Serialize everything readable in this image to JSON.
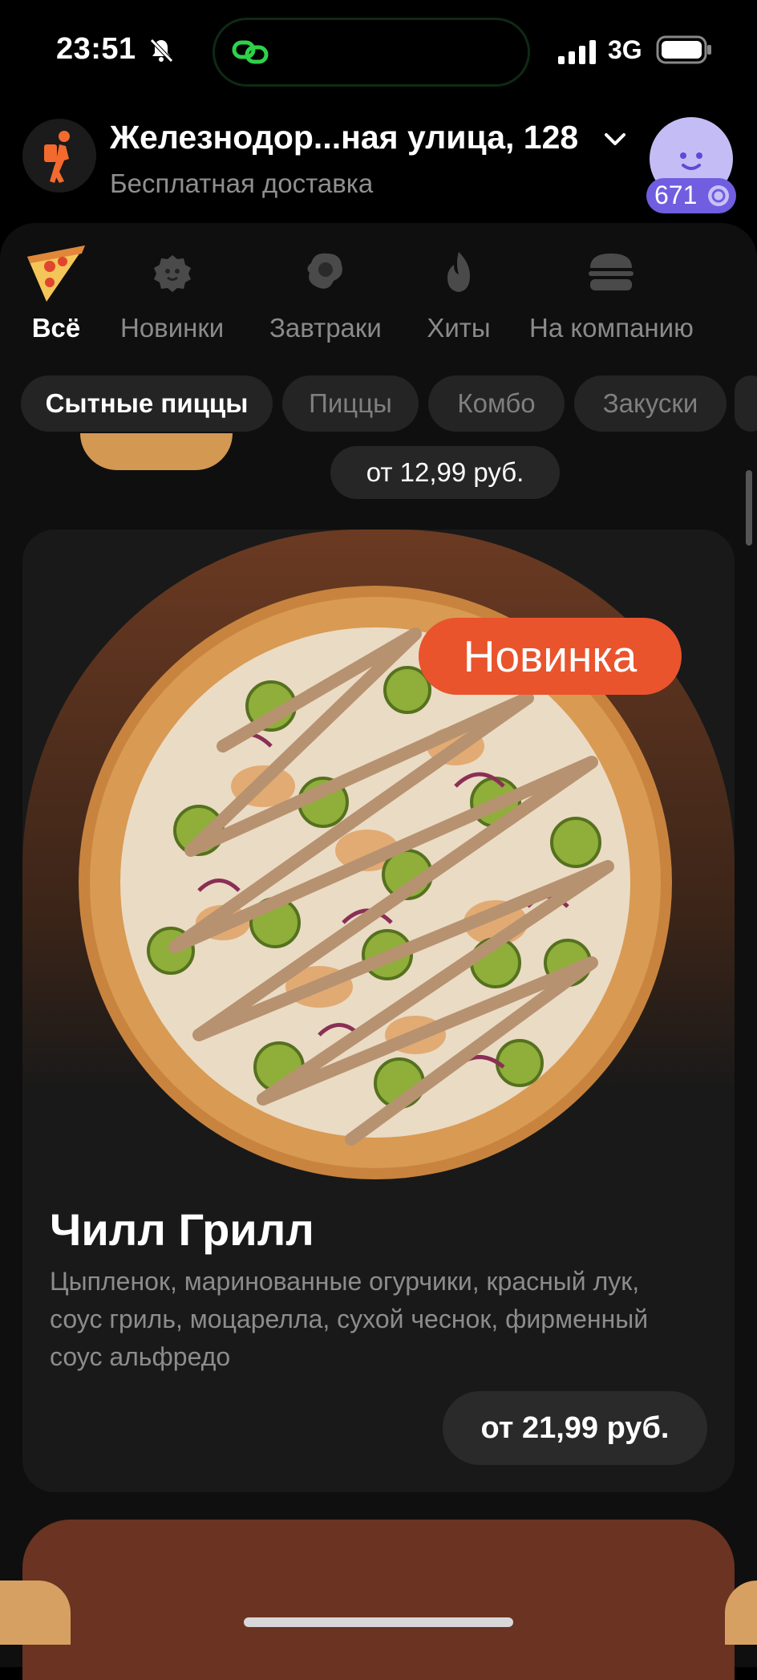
{
  "status_bar": {
    "time": "23:51",
    "network": "3G"
  },
  "header": {
    "address": "Железнодор...ная улица, 128",
    "delivery_note": "Бесплатная доставка",
    "points": "671"
  },
  "categories": [
    {
      "label": "Всё",
      "icon": "pizza-slice-icon",
      "active": true
    },
    {
      "label": "Новинки",
      "icon": "new-badge-icon",
      "active": false
    },
    {
      "label": "Завтраки",
      "icon": "fried-egg-icon",
      "active": false
    },
    {
      "label": "Хиты",
      "icon": "fire-icon",
      "active": false
    },
    {
      "label": "На компанию",
      "icon": "burger-icon",
      "active": false
    }
  ],
  "chips": [
    {
      "label": "Сытные пиццы",
      "active": true
    },
    {
      "label": "Пиццы",
      "active": false
    },
    {
      "label": "Комбо",
      "active": false
    },
    {
      "label": "Закуски",
      "active": false
    }
  ],
  "previous_item": {
    "price": "от 12,99 руб."
  },
  "product": {
    "badge": "Новинка",
    "name": "Чилл Грилл",
    "description": "Цыпленок, маринованные огурчики, красный лук, соус гриль, моцарелла, сухой чеснок, фирменный соус альфредо",
    "price": "от 21,99 руб."
  },
  "colors": {
    "accent": "#e9542d",
    "points_badge": "#6f5ee0",
    "avatar": "#c4bdf5"
  }
}
